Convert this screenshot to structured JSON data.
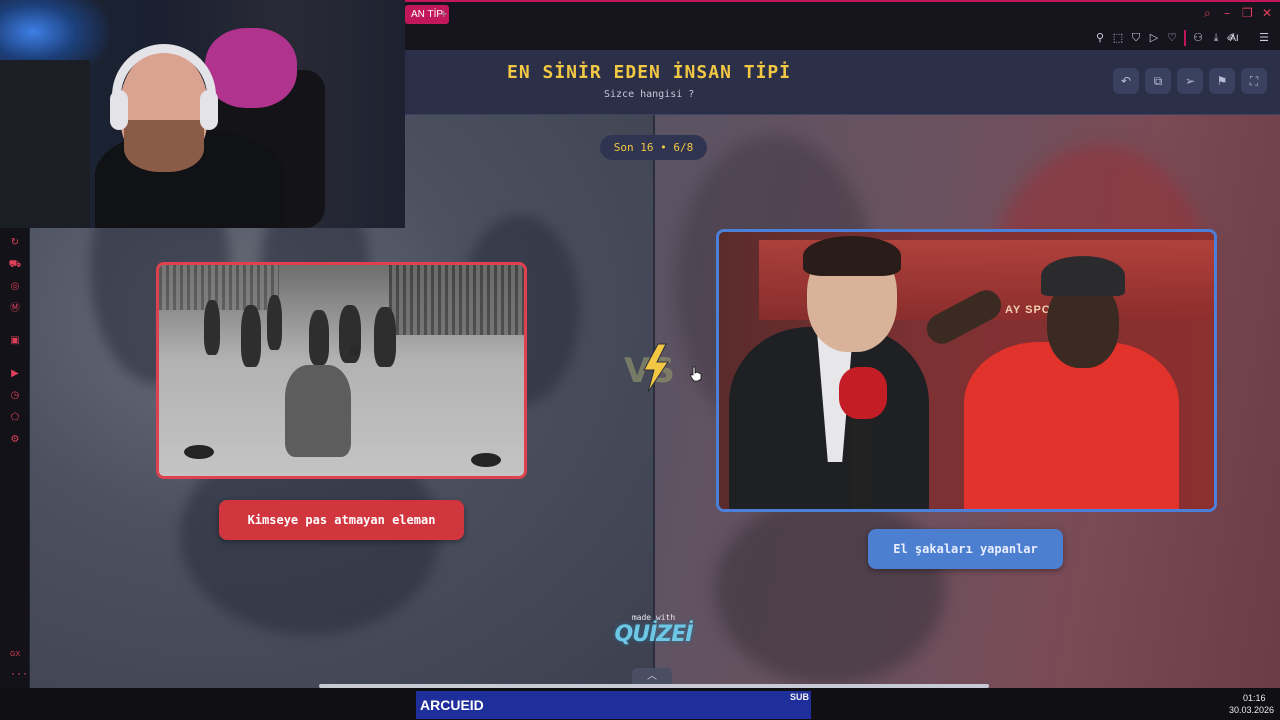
{
  "browser": {
    "tab_title": "AN TİP",
    "new_tab": "+",
    "ai_label": "AI",
    "window_controls": [
      "search-icon",
      "minimize-icon",
      "restore-icon",
      "close-icon"
    ],
    "toolbar_icons": [
      "pin-icon",
      "snapshot-icon",
      "shield-icon",
      "play-icon",
      "heart-icon",
      "account-icon",
      "download-icon",
      "aria-icon",
      "menu-icon"
    ],
    "sidebar_icons": [
      "refresh-icon",
      "bag-icon",
      "instagram-icon",
      "messenger-icon",
      "twitch-icon",
      "player-icon",
      "history-icon",
      "extension-icon",
      "settings-icon"
    ],
    "sidebar_gx": "GX",
    "sidebar_more": "···"
  },
  "quiz": {
    "title": "EN SİNİR EDEN İNSAN TİPİ",
    "subtitle": "Sizce hangisi ?",
    "round": "Son 16 • 6/8",
    "header_buttons": [
      "undo-icon",
      "share-icon",
      "send-icon",
      "flag-icon",
      "fullscreen-icon"
    ],
    "vs_label": "VS",
    "left_option": "Kimseye pas atmayan eleman",
    "right_option": "El şakaları yapanlar",
    "right_banner": "AY SPOR KULÜBÜ",
    "made_with": "made with",
    "brand": "QUİZEİ",
    "scroll_up": "︿"
  },
  "taskbar": {
    "name": "ARCUEID",
    "badge": "SUB",
    "time": "01:16",
    "date": "30.03.2026"
  },
  "colors": {
    "accent_left": "#d1363f",
    "accent_right": "#4d7fd0",
    "title_yellow": "#f2c744",
    "opera_red": "#c2185b"
  }
}
